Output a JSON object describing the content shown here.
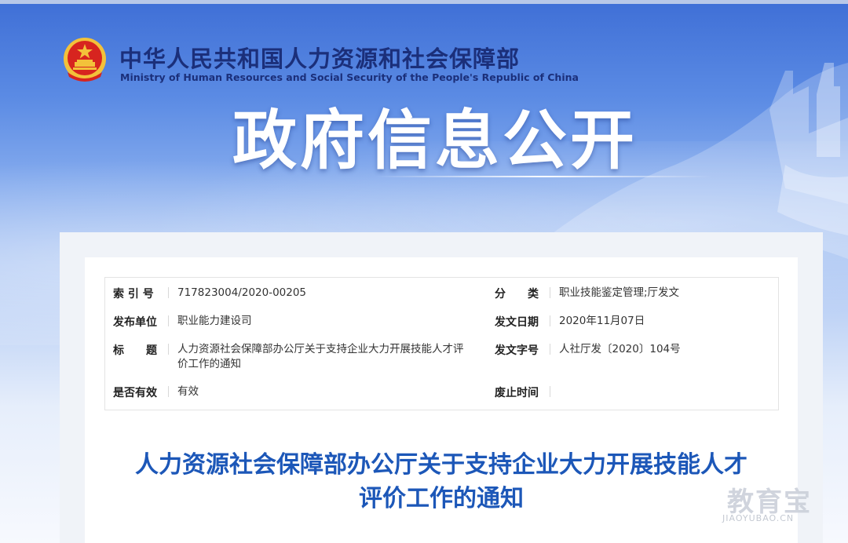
{
  "header": {
    "org_cn": "中华人民共和国人力资源和社会保障部",
    "org_en": "Ministry of Human Resources and Social Security of the People's Republic of China",
    "banner": "政府信息公开",
    "emblem_icon": "national-emblem-icon"
  },
  "meta": {
    "index_label": "索 引 号",
    "index_value": "717823004/2020-00205",
    "category_label": "分　　类",
    "category_value": "职业技能鉴定管理;厅发文",
    "issuer_label": "发布单位",
    "issuer_value": "职业能力建设司",
    "date_label": "发文日期",
    "date_value": "2020年11月07日",
    "title_label": "标　　题",
    "title_value_line1": "人力资源社会保障部办公厅关于支持企业大力开展技能人才评",
    "title_value_line2": "价工作的通知",
    "docno_label": "发文字号",
    "docno_value": "人社厅发〔2020〕104号",
    "valid_label": "是否有效",
    "valid_value": "有效",
    "expire_label": "废止时间",
    "expire_value": ""
  },
  "article": {
    "title_line1": "人力资源社会保障部办公厅关于支持企业大力开展技能人才",
    "title_line2": "评价工作的通知"
  },
  "watermark": {
    "cn": "教育宝",
    "en": "JIAOYUBAO.CN"
  },
  "colors": {
    "title_blue": "#1c57b8",
    "org_navy": "#1b2f7a",
    "emblem_red": "#d7241f",
    "emblem_gold": "#f3c13a"
  }
}
